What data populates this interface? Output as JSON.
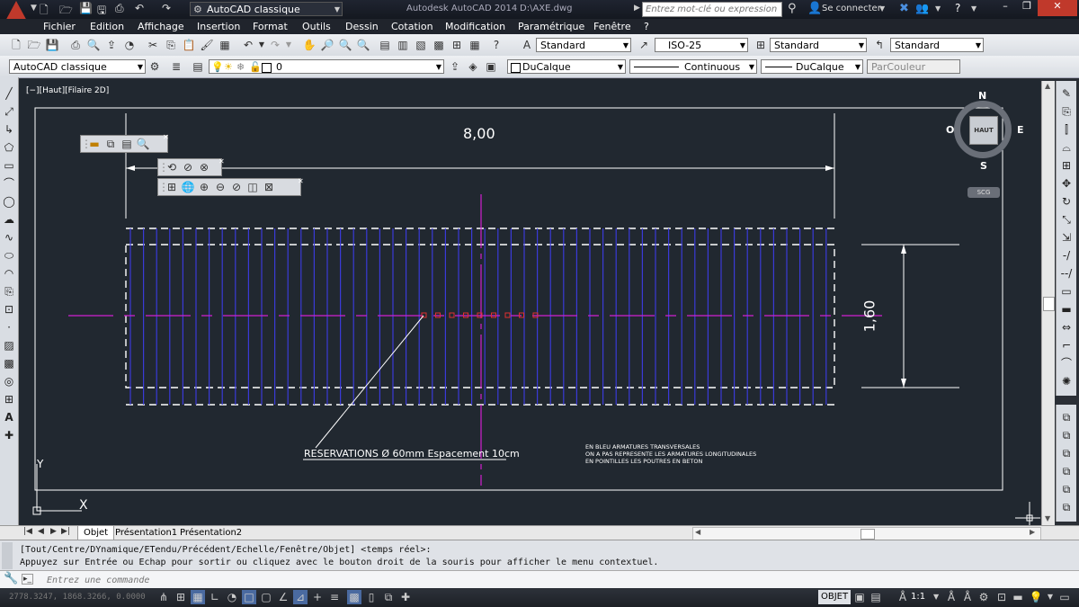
{
  "titlebar": {
    "workspace": "AutoCAD classique",
    "app_title": "Autodesk AutoCAD 2014",
    "file_path": "D:\\AXE.dwg",
    "search_placeholder": "Entrez mot-clé ou expression",
    "signin": "Se connecter"
  },
  "menu": [
    "Fichier",
    "Edition",
    "Affichage",
    "Insertion",
    "Format",
    "Outils",
    "Dessin",
    "Cotation",
    "Modification",
    "Paramétrique",
    "Fenêtre",
    "?"
  ],
  "styles": {
    "text_style": "Standard",
    "dim_style": "ISO-25",
    "table_style": "Standard",
    "mleader_style": "Standard"
  },
  "layers": {
    "workspace": "AutoCAD classique",
    "layer": "0",
    "color": "DuCalque",
    "linetype": "Continuous",
    "lineweight": "DuCalque",
    "plotstyle": "ParCouleur"
  },
  "viewport": {
    "label": "[−][Haut][Filaire 2D]",
    "dim_horizontal": "8,00",
    "dim_vertical": "1,60",
    "annotation": "RESERVATIONS Ø 60mm Espacement 10cm",
    "note_lines": [
      "EN BLEU ARMATURES TRANSVERSALES",
      "ON A PAS REPRESENTE LES ARMATURES LONGITUDINALES",
      "EN POINTILLES LES POUTRES EN BETON"
    ],
    "ucs_y": "Y",
    "ucs_x": "X"
  },
  "viewcube": {
    "n": "N",
    "s": "S",
    "e": "E",
    "o": "O",
    "face": "HAUT",
    "scg": "SCG"
  },
  "tabs": [
    "Objet",
    "Présentation1",
    "Présentation2"
  ],
  "command": {
    "line1": "[Tout/Centre/DYnamique/ETendu/Précédent/Echelle/Fenêtre/Objet] <temps réel>:",
    "line2": "Appuyez sur Entrée ou Echap pour sortir ou cliquez avec le bouton droit de la souris pour afficher le menu contextuel.",
    "placeholder": "Entrez une commande"
  },
  "status": {
    "coords": "2778.3247, 1868.3266, 0.0000",
    "objet": "OBJET",
    "scale": "1:1"
  }
}
